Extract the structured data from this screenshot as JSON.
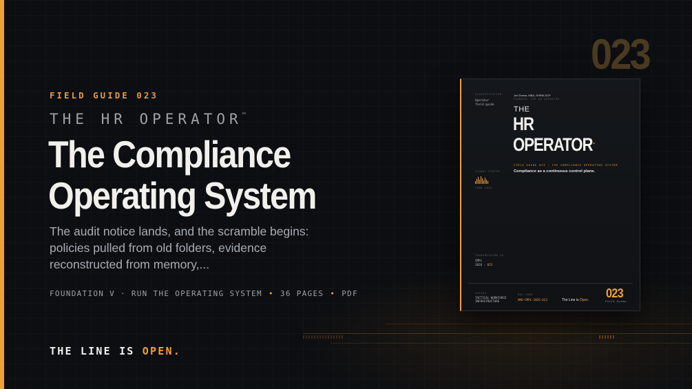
{
  "eyebrow": "FIELD GUIDE 023",
  "brand": {
    "name": "THE HR OPERATOR",
    "mark": "™"
  },
  "headline": {
    "line1": "The Compliance",
    "line2": "Operating System"
  },
  "lede": "The audit notice lands, and the scramble begins: policies pulled from old folders, evidence reconstructed from memory,...",
  "meta": {
    "series": "FOUNDATION V · RUN THE OPERATING SYSTEM",
    "pages": "36 PAGES",
    "format": "PDF"
  },
  "tagline": {
    "prefix": "THE LINE IS",
    "accent": "OPEN."
  },
  "issue_number": "023",
  "colors": {
    "accent": "#f0a03a",
    "background": "#0c0e11",
    "text": "#f2f0ec"
  },
  "cover": {
    "classification_label": "CLASSIFICATION",
    "classification_line1": "Operator",
    "classification_line2": "field guide",
    "author": "Jon Dreiza, MBA, SHRM-SCP",
    "founder": "FOUNDER, THE HR OPERATOR",
    "the": "THE",
    "title1": "HR",
    "title2": "OPERATOR",
    "title_mark": "™",
    "field_guide_line": "FIELD GUIDE 023 · THE COMPLIANCE OPERATING SYSTEM",
    "subtitle": "Compliance as a continuous control plane.",
    "signal_label": "SIGNAL STATUS",
    "signal_value": "CURR 2024",
    "transmission_label": "TRANSMISSION ID",
    "transmission_line1": "CMPL",
    "transmission_year": "2026",
    "transmission_code": "023",
    "series_label": "SERIES",
    "series_line1": "TACTICAL WORKFORCE",
    "series_line2": "INFRASTRUCTURE",
    "doc_label": "DOC CODE",
    "doc_code": "HRO-CMPL-2026-023",
    "line_prefix": "The Line is",
    "line_accent": "Open.",
    "number": "023",
    "number_caption": "Field Guide"
  }
}
